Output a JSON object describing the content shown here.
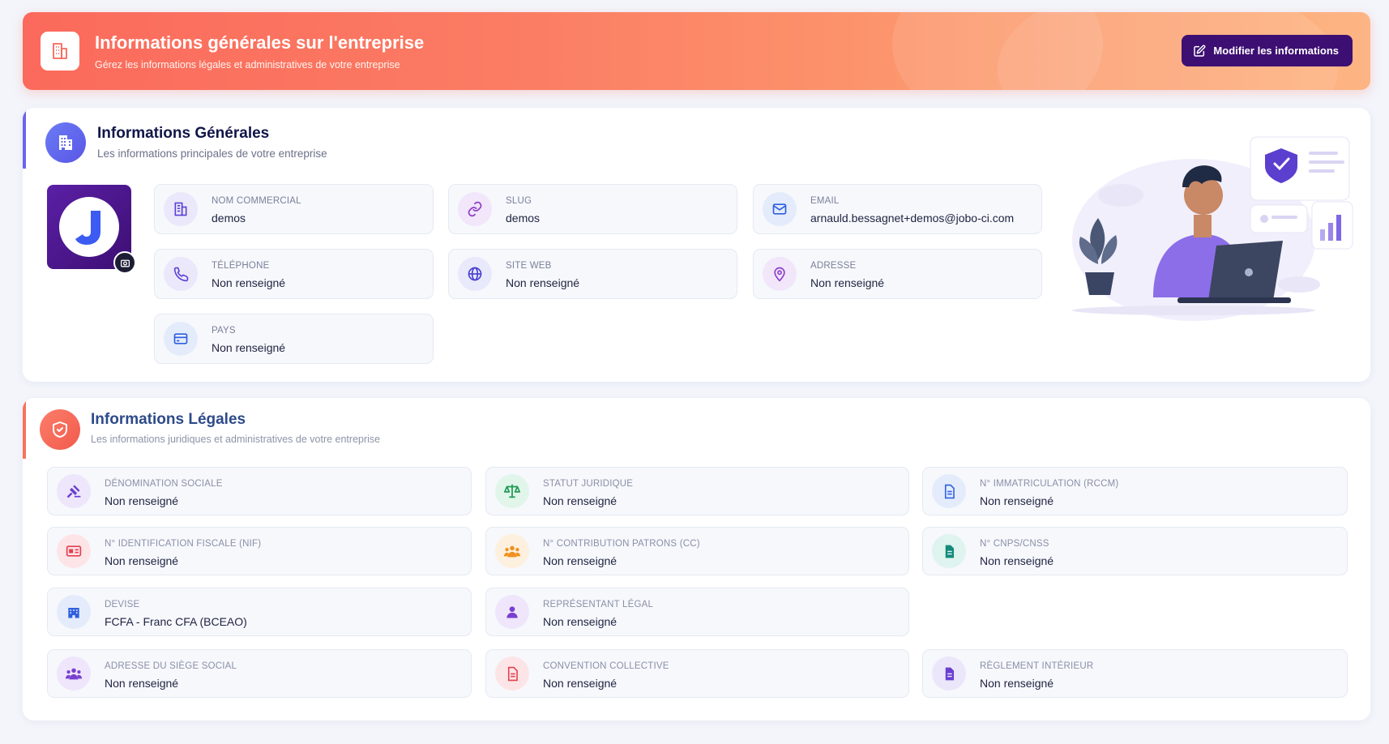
{
  "header": {
    "title": "Informations générales sur l'entreprise",
    "subtitle": "Gérez les informations légales et administratives de votre entreprise",
    "edit_button": "Modifier les informations"
  },
  "general": {
    "title": "Informations Générales",
    "subtitle": "Les informations principales de votre entreprise",
    "logo_letter": "J",
    "fields": [
      {
        "label": "Nom commercial",
        "value": "demos",
        "icon": "building-icon"
      },
      {
        "label": "Slug",
        "value": "demos",
        "icon": "link-icon"
      },
      {
        "label": "Email",
        "value": "arnauld.bessagnet+demos@jobo-ci.com",
        "icon": "mail-icon"
      },
      {
        "label": "Téléphone",
        "value": "Non renseigné",
        "icon": "phone-icon"
      },
      {
        "label": "Site web",
        "value": "Non renseigné",
        "icon": "globe-icon"
      },
      {
        "label": "Adresse",
        "value": "Non renseigné",
        "icon": "map-pin-icon"
      },
      {
        "label": "Pays",
        "value": "Non renseigné",
        "icon": "card-icon"
      }
    ]
  },
  "legal": {
    "title": "Informations Légales",
    "subtitle": "Les informations juridiques et administratives de votre entreprise",
    "fields": [
      {
        "label": "Dénomination sociale",
        "value": "Non renseigné",
        "icon": "gavel-icon"
      },
      {
        "label": "Statut juridique",
        "value": "Non renseigné",
        "icon": "scale-icon"
      },
      {
        "label": "N° Immatriculation (RCCM)",
        "value": "Non renseigné",
        "icon": "document-icon"
      },
      {
        "label": "N° Identification fiscale (NIF)",
        "value": "Non renseigné",
        "icon": "id-card-icon"
      },
      {
        "label": "N° Contribution patrons (CC)",
        "value": "Non renseigné",
        "icon": "users-icon"
      },
      {
        "label": "N° CNPS/CNSS",
        "value": "Non renseigné",
        "icon": "file-text-icon"
      },
      {
        "label": "Devise",
        "value": "FCFA - Franc CFA (BCEAO)",
        "icon": "bank-icon"
      },
      {
        "label": "Représentant légal",
        "value": "Non renseigné",
        "icon": "user-icon"
      },
      {
        "label": "Adresse du siège social",
        "value": "Non renseigné",
        "icon": "group-icon"
      },
      {
        "label": "Convention collective",
        "value": "Non renseigné",
        "icon": "doc-red-icon"
      },
      {
        "label": "Règlement intérieur",
        "value": "Non renseigné",
        "icon": "doc-purple-icon"
      }
    ]
  },
  "colors": {
    "banner_start": "#fb6a5c",
    "banner_end": "#fdb584",
    "primary_button": "#3d0f73",
    "general_accent": "#6b63ee",
    "legal_accent": "#f7725d"
  }
}
